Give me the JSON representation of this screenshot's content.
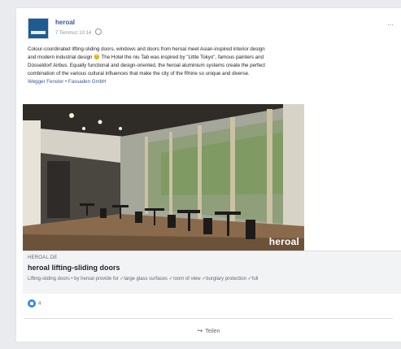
{
  "post": {
    "page_name": "heroal",
    "timestamp": "7 Temmuz 10:14",
    "text_lines": [
      "Colour-coordinated lifting-sliding doors, windows and doors from heroal meet Asian-inspired interior design",
      "and modern industrial design 😊 The Hotel the niu Tab was inspired by \"Little Tokyo\", famous painters and",
      "Düsseldorf Airbus. Equally functional and design-oriented, the heroal aluminium systems create the perfect",
      "combination of the various cultural influences that make the city of the Rhine so unique and diverse."
    ],
    "tags": "Wegger Fenster • Fassaden GmbH",
    "more_label": "…"
  },
  "image": {
    "watermark": "heroal"
  },
  "link": {
    "domain": "HEROAL.DE",
    "title": "heroal lifting-sliding doors",
    "description": "Lifting-sliding doors • by heroal provide for ✓large glass surfaces ✓room of view ✓burglary protection ✓full"
  },
  "reactions": {
    "count": "4"
  },
  "actions": {
    "share_label": "Teilen"
  },
  "colors": {
    "link_blue": "#385898",
    "reaction_blue": "#2d88ff",
    "brand_navy": "#1f5a93"
  }
}
